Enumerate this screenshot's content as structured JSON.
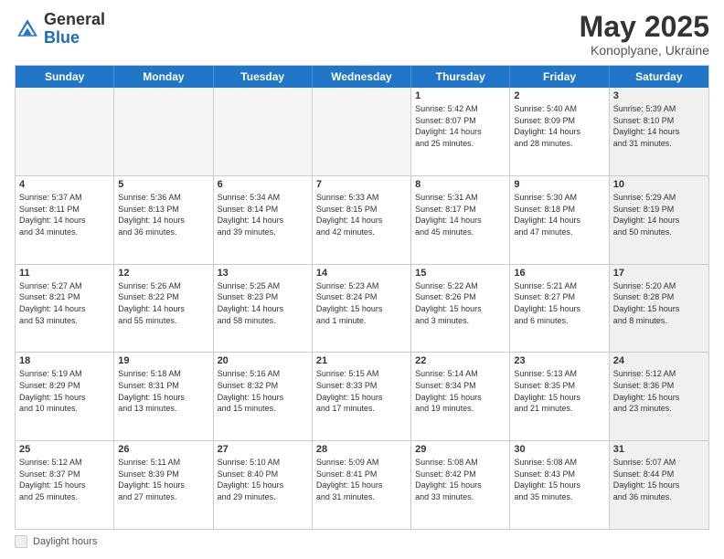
{
  "header": {
    "logo_general": "General",
    "logo_blue": "Blue",
    "title": "May 2025",
    "location": "Konoplyane, Ukraine"
  },
  "calendar": {
    "days_of_week": [
      "Sunday",
      "Monday",
      "Tuesday",
      "Wednesday",
      "Thursday",
      "Friday",
      "Saturday"
    ],
    "weeks": [
      [
        {
          "num": "",
          "detail": "",
          "empty": true
        },
        {
          "num": "",
          "detail": "",
          "empty": true
        },
        {
          "num": "",
          "detail": "",
          "empty": true
        },
        {
          "num": "",
          "detail": "",
          "empty": true
        },
        {
          "num": "1",
          "detail": "Sunrise: 5:42 AM\nSunset: 8:07 PM\nDaylight: 14 hours\nand 25 minutes."
        },
        {
          "num": "2",
          "detail": "Sunrise: 5:40 AM\nSunset: 8:09 PM\nDaylight: 14 hours\nand 28 minutes."
        },
        {
          "num": "3",
          "detail": "Sunrise: 5:39 AM\nSunset: 8:10 PM\nDaylight: 14 hours\nand 31 minutes.",
          "shaded": true
        }
      ],
      [
        {
          "num": "4",
          "detail": "Sunrise: 5:37 AM\nSunset: 8:11 PM\nDaylight: 14 hours\nand 34 minutes."
        },
        {
          "num": "5",
          "detail": "Sunrise: 5:36 AM\nSunset: 8:13 PM\nDaylight: 14 hours\nand 36 minutes."
        },
        {
          "num": "6",
          "detail": "Sunrise: 5:34 AM\nSunset: 8:14 PM\nDaylight: 14 hours\nand 39 minutes."
        },
        {
          "num": "7",
          "detail": "Sunrise: 5:33 AM\nSunset: 8:15 PM\nDaylight: 14 hours\nand 42 minutes."
        },
        {
          "num": "8",
          "detail": "Sunrise: 5:31 AM\nSunset: 8:17 PM\nDaylight: 14 hours\nand 45 minutes."
        },
        {
          "num": "9",
          "detail": "Sunrise: 5:30 AM\nSunset: 8:18 PM\nDaylight: 14 hours\nand 47 minutes."
        },
        {
          "num": "10",
          "detail": "Sunrise: 5:29 AM\nSunset: 8:19 PM\nDaylight: 14 hours\nand 50 minutes.",
          "shaded": true
        }
      ],
      [
        {
          "num": "11",
          "detail": "Sunrise: 5:27 AM\nSunset: 8:21 PM\nDaylight: 14 hours\nand 53 minutes."
        },
        {
          "num": "12",
          "detail": "Sunrise: 5:26 AM\nSunset: 8:22 PM\nDaylight: 14 hours\nand 55 minutes."
        },
        {
          "num": "13",
          "detail": "Sunrise: 5:25 AM\nSunset: 8:23 PM\nDaylight: 14 hours\nand 58 minutes."
        },
        {
          "num": "14",
          "detail": "Sunrise: 5:23 AM\nSunset: 8:24 PM\nDaylight: 15 hours\nand 1 minute."
        },
        {
          "num": "15",
          "detail": "Sunrise: 5:22 AM\nSunset: 8:26 PM\nDaylight: 15 hours\nand 3 minutes."
        },
        {
          "num": "16",
          "detail": "Sunrise: 5:21 AM\nSunset: 8:27 PM\nDaylight: 15 hours\nand 6 minutes."
        },
        {
          "num": "17",
          "detail": "Sunrise: 5:20 AM\nSunset: 8:28 PM\nDaylight: 15 hours\nand 8 minutes.",
          "shaded": true
        }
      ],
      [
        {
          "num": "18",
          "detail": "Sunrise: 5:19 AM\nSunset: 8:29 PM\nDaylight: 15 hours\nand 10 minutes."
        },
        {
          "num": "19",
          "detail": "Sunrise: 5:18 AM\nSunset: 8:31 PM\nDaylight: 15 hours\nand 13 minutes."
        },
        {
          "num": "20",
          "detail": "Sunrise: 5:16 AM\nSunset: 8:32 PM\nDaylight: 15 hours\nand 15 minutes."
        },
        {
          "num": "21",
          "detail": "Sunrise: 5:15 AM\nSunset: 8:33 PM\nDaylight: 15 hours\nand 17 minutes."
        },
        {
          "num": "22",
          "detail": "Sunrise: 5:14 AM\nSunset: 8:34 PM\nDaylight: 15 hours\nand 19 minutes."
        },
        {
          "num": "23",
          "detail": "Sunrise: 5:13 AM\nSunset: 8:35 PM\nDaylight: 15 hours\nand 21 minutes."
        },
        {
          "num": "24",
          "detail": "Sunrise: 5:12 AM\nSunset: 8:36 PM\nDaylight: 15 hours\nand 23 minutes.",
          "shaded": true
        }
      ],
      [
        {
          "num": "25",
          "detail": "Sunrise: 5:12 AM\nSunset: 8:37 PM\nDaylight: 15 hours\nand 25 minutes."
        },
        {
          "num": "26",
          "detail": "Sunrise: 5:11 AM\nSunset: 8:39 PM\nDaylight: 15 hours\nand 27 minutes."
        },
        {
          "num": "27",
          "detail": "Sunrise: 5:10 AM\nSunset: 8:40 PM\nDaylight: 15 hours\nand 29 minutes."
        },
        {
          "num": "28",
          "detail": "Sunrise: 5:09 AM\nSunset: 8:41 PM\nDaylight: 15 hours\nand 31 minutes."
        },
        {
          "num": "29",
          "detail": "Sunrise: 5:08 AM\nSunset: 8:42 PM\nDaylight: 15 hours\nand 33 minutes."
        },
        {
          "num": "30",
          "detail": "Sunrise: 5:08 AM\nSunset: 8:43 PM\nDaylight: 15 hours\nand 35 minutes."
        },
        {
          "num": "31",
          "detail": "Sunrise: 5:07 AM\nSunset: 8:44 PM\nDaylight: 15 hours\nand 36 minutes.",
          "shaded": true
        }
      ]
    ]
  },
  "footer": {
    "label": "Daylight hours"
  }
}
